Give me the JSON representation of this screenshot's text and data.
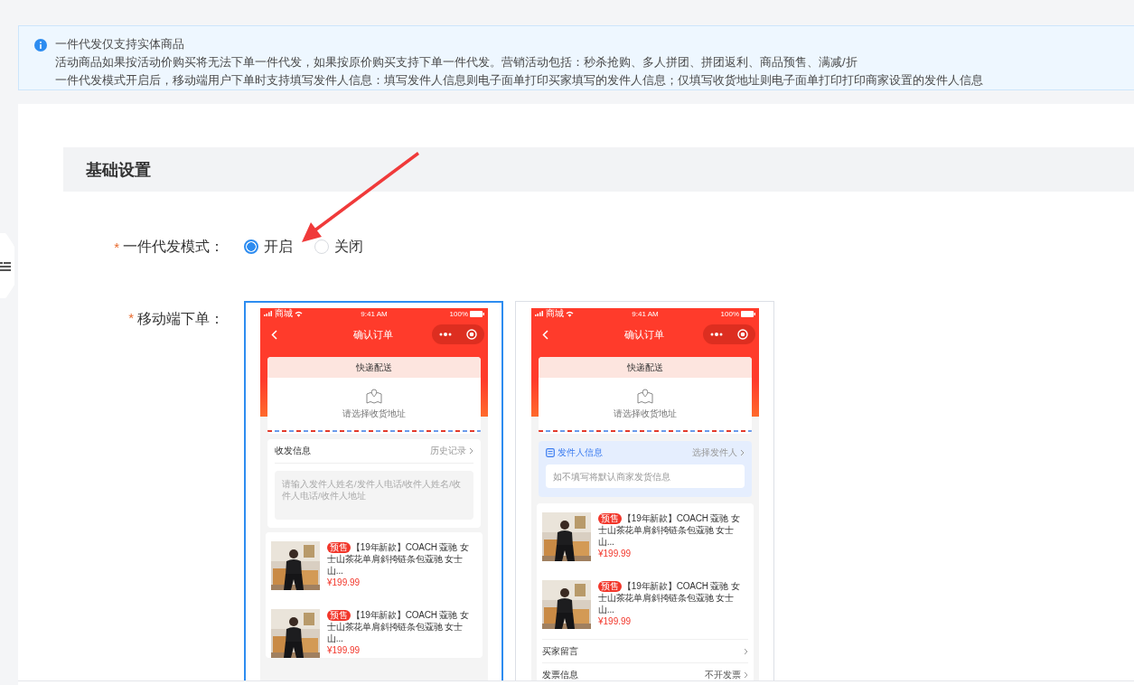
{
  "notice": {
    "title": "一件代发仅支持实体商品",
    "lines": [
      "活动商品如果按活动价购买将无法下单一件代发，如果按原价购买支持下单一件代发。营销活动包括：秒杀抢购、多人拼团、拼团返利、商品预售、满减/折",
      "一件代发模式开启后，移动端用户下单时支持填写发件人信息：填写发件人信息则电子面单打印买家填写的发件人信息；仅填写收货地址则电子面单打印打印商家设置的发件人信息"
    ]
  },
  "section": {
    "title": "基础设置"
  },
  "mode_field": {
    "required_mark": "*",
    "label": "一件代发模式：",
    "options": [
      {
        "label": "开启",
        "selected": true
      },
      {
        "label": "关闭",
        "selected": false
      }
    ]
  },
  "mobile_field": {
    "required_mark": "*",
    "label": "移动端下单：",
    "previews": [
      {
        "selected": true,
        "carrier": "商城",
        "time": "9:41 AM",
        "battery": "100%",
        "nav_title": "确认订单",
        "delivery_title": "快递配送",
        "address_hint": "请选择收货地址",
        "info": {
          "kind": "recipient_form",
          "title": "收发信息",
          "link": "历史记录",
          "placeholder": "请输入发件人姓名/发件人电话/收件人姓名/收件人电话/收件人地址"
        },
        "products": [
          {
            "tag": "预售",
            "title": "【19年新款】COACH 蔻驰 女士山茶花单肩斜挎链条包蔻驰 女士山...",
            "price": "¥199.99"
          },
          {
            "tag": "预售",
            "title": "【19年新款】COACH 蔻驰 女士山茶花单肩斜挎链条包蔻驰 女士山...",
            "price": "¥199.99"
          }
        ]
      },
      {
        "selected": false,
        "carrier": "商城",
        "time": "9:41 AM",
        "battery": "100%",
        "nav_title": "确认订单",
        "delivery_title": "快递配送",
        "address_hint": "请选择收货地址",
        "info": {
          "kind": "sender_info",
          "title": "发件人信息",
          "link": "选择发件人",
          "placeholder": "如不填写将默认商家发货信息"
        },
        "products": [
          {
            "tag": "预售",
            "title": "【19年新款】COACH 蔻驰 女士山茶花单肩斜挎链条包蔻驰 女士山...",
            "price": "¥199.99"
          },
          {
            "tag": "预售",
            "title": "【19年新款】COACH 蔻驰 女士山茶花单肩斜挎链条包蔻驰 女士山...",
            "price": "¥199.99"
          }
        ],
        "rows": [
          {
            "label": "买家留言"
          },
          {
            "label": "发票信息",
            "value": "不开发票"
          }
        ]
      }
    ]
  }
}
